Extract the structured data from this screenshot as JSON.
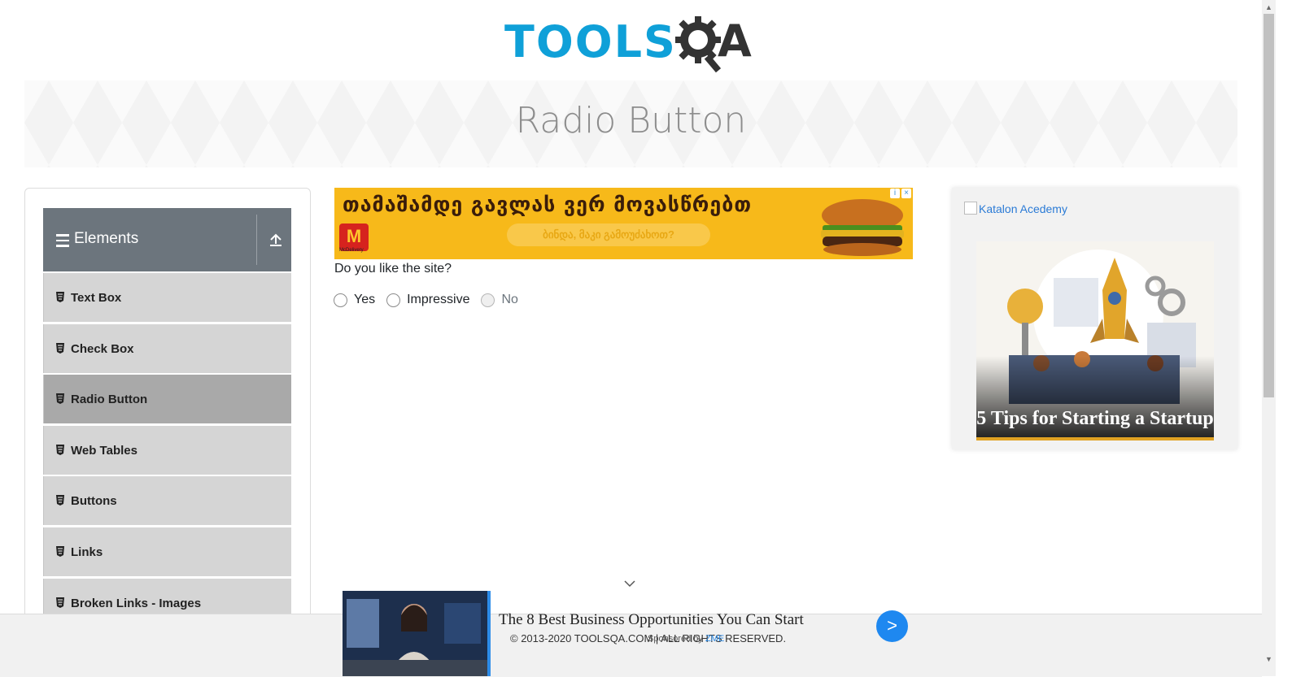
{
  "header": {
    "logo_text": "TOOLS",
    "logo_suffix": "A"
  },
  "banner": {
    "title": "Radio Button"
  },
  "sidebar": {
    "group_label": "Elements",
    "items": [
      {
        "label": "Text Box"
      },
      {
        "label": "Check Box"
      },
      {
        "label": "Radio Button",
        "active": true
      },
      {
        "label": "Web Tables"
      },
      {
        "label": "Buttons"
      },
      {
        "label": "Links"
      },
      {
        "label": "Broken Links - Images"
      }
    ]
  },
  "ad_top": {
    "headline": "თამაშამდე გავლას ვერ მოვასწრებთ",
    "subline": "ბინდა, მაკი გამოუძახოთ?",
    "brand": "McDelivery",
    "logo_letter": "M"
  },
  "main": {
    "question": "Do you like the site?",
    "options": [
      {
        "label": "Yes",
        "disabled": false
      },
      {
        "label": "Impressive",
        "disabled": false
      },
      {
        "label": "No",
        "disabled": true
      }
    ]
  },
  "right_ad": {
    "link_text": "Katalon Acedemy",
    "caption": "5 Tips for Starting a Startup"
  },
  "bottom_ad": {
    "title": "The 8 Best Business Opportunities You Can Start",
    "sponsor_prefix": "Sponsored by",
    "sponsor_name": "ZME",
    "button_label": ">"
  },
  "footer": {
    "copyright": "© 2013-2020 TOOLSQA.COM | ALL RIGHTS RESERVED."
  },
  "colors": {
    "brand_blue": "#0fa0d8",
    "group_header": "#6c757d",
    "active_item": "#a9a9a9",
    "ad_yellow": "#f7b91a"
  }
}
